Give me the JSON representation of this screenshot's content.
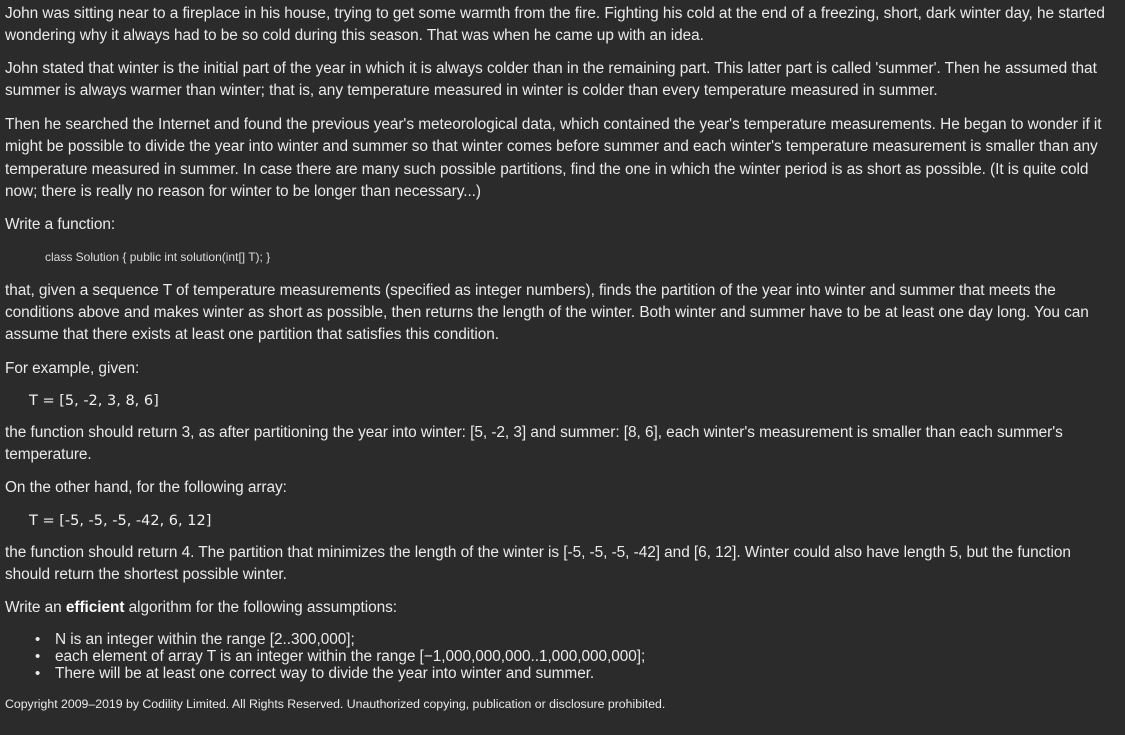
{
  "paragraphs": {
    "p1": "John was sitting near to a fireplace in his house, trying to get some warmth from the fire. Fighting his cold at the end of a freezing, short, dark winter day, he started wondering why it always had to be so cold during this season. That was when he came up with an idea.",
    "p2": "John stated that winter is the initial part of the year in which it is always colder than in the remaining part. This latter part is called 'summer'. Then he assumed that summer is always warmer than winter; that is, any temperature measured in winter is colder than every temperature measured in summer.",
    "p3": "Then he searched the Internet and found the previous year's meteorological data, which contained the year's temperature measurements. He began to wonder if it might be possible to divide the year into winter and summer so that winter comes before summer and each winter's temperature measurement is smaller than any temperature measured in summer. In case there are many such possible partitions, find the one in which the winter period is as short as possible. (It is quite cold now; there is really no reason for winter to be longer than necessary...)",
    "write_function": "Write a function:",
    "p4": "that, given a sequence T of temperature measurements (specified as integer numbers), finds the partition of the year into winter and summer that meets the conditions above and makes winter as short as possible, then returns the length of the winter. Both winter and summer have to be at least one day long. You can assume that there exists at least one partition that satisfies this condition.",
    "for_example": "For example, given:",
    "result1": "the function should return 3, as after partitioning the year into winter: [5, -2, 3] and summer: [8, 6], each winter's measurement is smaller than each summer's temperature.",
    "other_hand": "On the other hand, for the following array:",
    "result2": "the function should return 4. The partition that minimizes the length of the winter is [-5, -5, -5, -42] and [6, 12]. Winter could also have length 5, but the function should return the shortest possible winter.",
    "write_efficient_pre": "Write an ",
    "write_efficient_bold": "efficient",
    "write_efficient_post": " algorithm for the following assumptions:"
  },
  "code_signature": "class Solution { public int solution(int[] T); }",
  "examples": {
    "example1": "T = [5, -2, 3, 8, 6]",
    "example2": "T = [-5, -5, -5, -42, 6, 12]"
  },
  "assumptions": [
    "N is an integer within the range [2..300,000];",
    "each element of array T is an integer within the range [−1,000,000,000..1,000,000,000];",
    "There will be at least one correct way to divide the year into winter and summer."
  ],
  "bullet_glyph": "•",
  "copyright": "Copyright 2009–2019 by Codility Limited. All Rights Reserved. Unauthorized copying, publication or disclosure prohibited."
}
